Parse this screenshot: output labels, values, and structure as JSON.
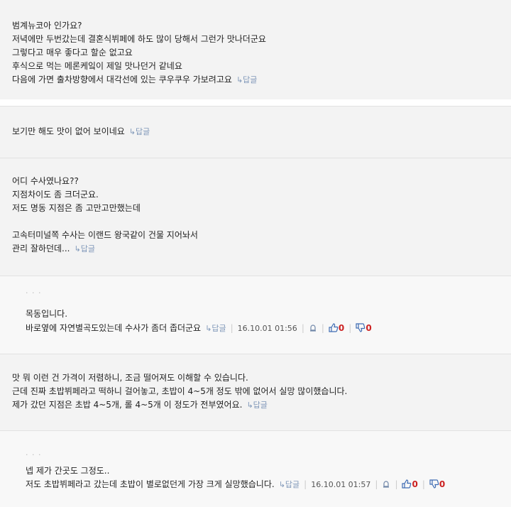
{
  "comments": [
    {
      "lines": [
        "범계뉴코아 인가요?",
        "저녁에만 두번갔는데 결혼식뷔페에 하도 많이 당해서 그런가 맛나더군요",
        "그렇다고 매우 좋다고 할순 없고요",
        "후식으로 먹는 메론케잌이 제일 맛나던거 같네요",
        "다음에 가면 출차방향에서 대각선에 있는 쿠우쿠우 가보려고요"
      ],
      "reply_label": "↳답글"
    },
    {
      "lines": [
        "보기만 해도 맛이 없어 보이네요"
      ],
      "reply_label": "↳답글"
    },
    {
      "lines": [
        "어디 수사였나요??",
        "지점차이도 좀 크더군요.",
        "저도 명동 지점은 좀 고만고만했는데",
        "",
        "고속터미널쪽 수사는 이랜드 왕국같이 건물 지어놔서",
        "관리 잘하던데..."
      ],
      "reply_label": "↳답글"
    },
    {
      "nick": "· · ·",
      "lines": [
        "목동입니다.",
        "바로옆에 자연별곡도있는데 수사가 좀더 좁더군요"
      ],
      "reply_label": "↳답글",
      "date": "16.10.01 01:56",
      "up": "0",
      "down": "0"
    },
    {
      "lines": [
        "맛 뭐 이런 건 가격이 저렴하니, 조금 떨어져도 이해할 수 있습니다.",
        "근데 진짜 초밥뷔페라고 떡하니 걸어놓고, 초밥이 4~5개 정도 밖에 없어서 실망 많이했습니다.",
        "제가 갔던 지점은 초밥 4~5개, 롤 4~5개 이 정도가 전부였어요."
      ],
      "reply_label": "↳답글"
    },
    {
      "nick": "· · ·",
      "lines": [
        "넵 제가 간곳도 그정도..",
        "저도 초밥뷔페라고 갔는데 초밥이 별로없던게 가장 크게 실망했습니다."
      ],
      "reply_label": "↳답글",
      "date": "16.10.01 01:57",
      "up": "0",
      "down": "0"
    }
  ]
}
